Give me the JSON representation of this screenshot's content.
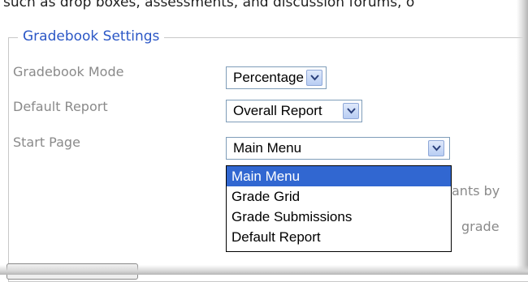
{
  "header_text": "such as drop boxes, assessments, and discussion forums, o",
  "fieldset": {
    "legend": "Gradebook Settings"
  },
  "fields": {
    "mode": {
      "label": "Gradebook Mode",
      "value": "Percentage"
    },
    "report": {
      "label": "Default Report",
      "value": "Overall Report"
    },
    "start": {
      "label": "Start Page",
      "value": "Main Menu"
    }
  },
  "dropdown": {
    "options": [
      "Main Menu",
      "Grade Grid",
      "Grade Submissions",
      "Default Report"
    ],
    "selected": "Main Menu"
  },
  "partial_text": {
    "line1": "ants by",
    "line2": "grade"
  },
  "colors": {
    "legend": "#2b57c6",
    "selected_bg": "#3167d1",
    "label": "#8a8a8a"
  }
}
